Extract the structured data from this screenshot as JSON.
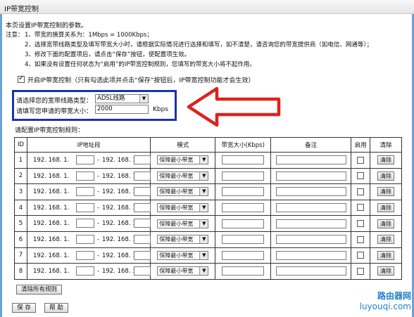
{
  "window": {
    "title": "IP带宽控制"
  },
  "intro": "本页设置IP带宽控制的参数。",
  "notes": {
    "label": "注意：",
    "items": [
      "1、带宽的换算关系为：1Mbps = 1000Kbps；",
      "2、选择宽带线路类型及填写带宽大小时，请根据实际情况进行选择和填写，如不清楚，请咨询您的带宽提供商（如电信、网通等）；",
      "3、修改下面的配置项后，请点击“保存”按钮，使配置项生效。",
      "4、如果没有设置任何状态为“启用”的IP带宽控制规则，您填写的带宽大小将不起作用。"
    ]
  },
  "enable_control": {
    "label": "开启IP带宽控制（只有勾选此项并点击“保存”按钮后，IP带宽控制功能才会生效）",
    "checked": true
  },
  "line_type": {
    "label": "请选择您的宽带线路类型：",
    "value": "ADSL线路"
  },
  "bandwidth": {
    "label": "请填写您申请的带宽大小：",
    "value": "2000",
    "unit": "Kbps"
  },
  "rules_label": "请配置IP带宽控制规则：",
  "table": {
    "headers": {
      "id": "ID",
      "ip": "IP地址段",
      "mode": "模式",
      "size": "带宽大小(Kbps)",
      "remark": "备注",
      "enable": "启用",
      "clear": "清除"
    },
    "ip_prefix": "192. 168. 1.",
    "ip_dash": "-",
    "mode_value": "保障最小带宽",
    "clear_label": "清除",
    "rows": [
      "1",
      "2",
      "3",
      "4",
      "5",
      "6",
      "7",
      "8"
    ]
  },
  "clear_all_label": "清除所有规则",
  "footer": {
    "save_label": "保 存",
    "help_label": "帮 助"
  },
  "watermark": {
    "cn": "路由器网",
    "en": "luyouqi.com"
  },
  "colors": {
    "highlight_box": "#1b33a8",
    "arrow": "#e0211c"
  }
}
